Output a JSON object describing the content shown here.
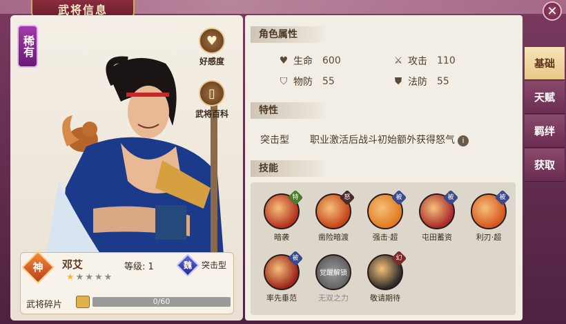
{
  "window": {
    "title": "武将信息"
  },
  "hero": {
    "rarity": "稀有",
    "faction_badge": "神",
    "name": "邓艾",
    "level_label": "等级: 1",
    "kingdom": "魏",
    "class_type": "突击型",
    "stars_filled": 1,
    "stars_total": 5,
    "shard_label": "武将碎片",
    "shard_progress_text": "0/60",
    "shard_progress_fraction": 0.0
  },
  "side_buttons": [
    {
      "label": "好感度",
      "icon": "heart-icon"
    },
    {
      "label": "武将百科",
      "icon": "book-icon"
    }
  ],
  "attributes": {
    "section_title": "角色属性",
    "items": [
      {
        "label": "生命",
        "value": "600",
        "icon": "heart-icon"
      },
      {
        "label": "攻击",
        "value": "110",
        "icon": "sword-icon"
      },
      {
        "label": "物防",
        "value": "55",
        "icon": "shield-icon"
      },
      {
        "label": "法防",
        "value": "55",
        "icon": "magic-shield-icon"
      }
    ]
  },
  "trait": {
    "section_title": "特性",
    "name": "突击型",
    "description": "职业激活后战斗初始额外获得怒气",
    "info_glyph": "i"
  },
  "skills": {
    "section_title": "技能",
    "items": [
      {
        "name": "暗袭",
        "tag": "特",
        "color": "#b4301e"
      },
      {
        "name": "凿险暗渡",
        "tag": "怒",
        "color": "#c4441a"
      },
      {
        "name": "强击·超",
        "tag": "被",
        "color": "#e07a1e"
      },
      {
        "name": "屯田蓄资",
        "tag": "被",
        "color": "#a82a2a"
      },
      {
        "name": "利刃·超",
        "tag": "被",
        "color": "#d4561e"
      },
      {
        "name": "率先垂范",
        "tag": "被",
        "color": "#9a2418"
      },
      {
        "name": "无双之力",
        "tag": "",
        "locked_text": "觉醒解锁",
        "color": "#6a6a6a",
        "locked": true
      },
      {
        "name": "敬请期待",
        "tag": "幻",
        "color": "#2a2a2a"
      }
    ]
  },
  "tabs": [
    {
      "label": "基础",
      "active": true
    },
    {
      "label": "天赋",
      "active": false
    },
    {
      "label": "羁绊",
      "active": false
    },
    {
      "label": "获取",
      "active": false
    }
  ],
  "colors": {
    "accent_gold": "#e8c88a",
    "frame_purple": "#6a2c50",
    "star_on": "#f5b82a",
    "progress_fill": "#e8a43a"
  }
}
